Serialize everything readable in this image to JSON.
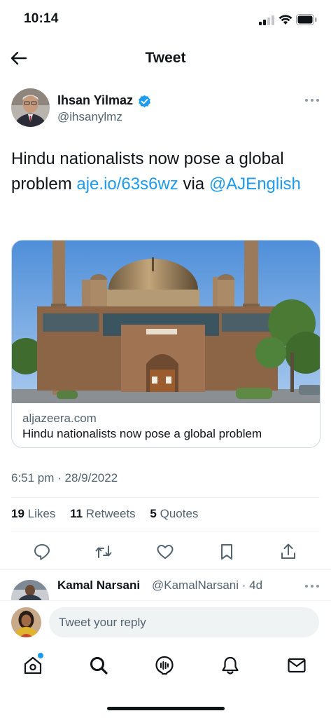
{
  "status_bar": {
    "time": "10:14"
  },
  "header": {
    "title": "Tweet"
  },
  "tweet": {
    "author_name": "Ihsan Yilmaz",
    "author_handle": "@ihsanylmz",
    "text_plain": "Hindu nationalists now pose a global problem ",
    "link": "aje.io/63s6wz",
    "text_via": " via ",
    "mention": "@AJEnglish",
    "card": {
      "domain": "aljazeera.com",
      "title": "Hindu nationalists now pose a global problem"
    },
    "timestamp": "6:51 pm · 28/9/2022",
    "stats": {
      "likes_count": "19",
      "likes_label": "Likes",
      "retweets_count": "11",
      "retweets_label": "Retweets",
      "quotes_count": "5",
      "quotes_label": "Quotes"
    }
  },
  "reply_preview": {
    "name": "Kamal Narsani",
    "handle_time": "@KamalNarsani · 4d"
  },
  "reply_bar": {
    "placeholder": "Tweet your reply"
  },
  "icons": {
    "actions": [
      "reply-icon",
      "retweet-icon",
      "like-icon",
      "bookmark-icon",
      "share-icon"
    ],
    "nav": [
      "home-icon",
      "search-icon",
      "spaces-icon",
      "notifications-icon",
      "messages-icon"
    ]
  },
  "colors": {
    "accent": "#1d9bf0",
    "text": "#0f1419",
    "secondary": "#536471"
  }
}
